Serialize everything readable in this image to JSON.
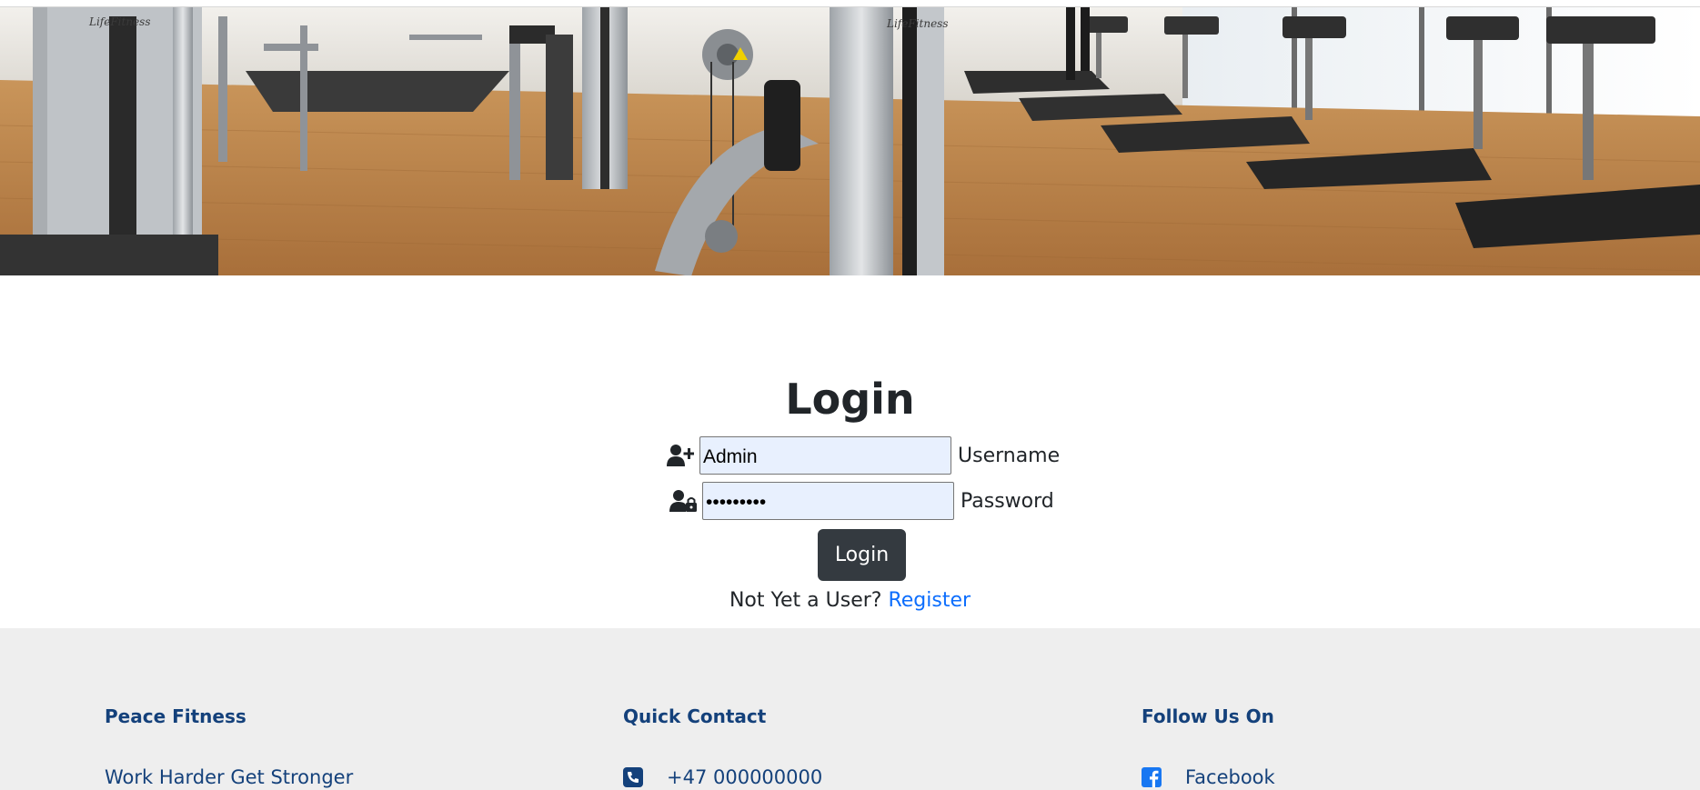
{
  "login": {
    "title": "Login",
    "username_value": "Admin",
    "username_label": "Username",
    "password_value": "•••••••••",
    "password_label": "Password",
    "submit_label": "Login",
    "register_prompt": "Not Yet a User?",
    "register_link": "Register"
  },
  "icons": {
    "username": "user-plus-icon",
    "password": "user-lock-icon",
    "phone": "phone-square-icon",
    "facebook": "facebook-square-icon"
  },
  "footer": {
    "brand": {
      "heading": "Peace Fitness",
      "tagline": "Work Harder Get Stronger"
    },
    "contact": {
      "heading": "Quick Contact",
      "phone": "+47 000000000"
    },
    "social": {
      "heading": "Follow Us On",
      "facebook": "Facebook"
    }
  },
  "hero_brand_marks": [
    "LifeFitness",
    "LifeFitness"
  ],
  "colors": {
    "button_dark": "#343a40",
    "link_blue": "#0d6efd",
    "footer_bg": "#eeeeee",
    "footer_text": "#14417b",
    "autofill_bg": "#e8f0fe",
    "facebook_blue": "#1877f2"
  }
}
